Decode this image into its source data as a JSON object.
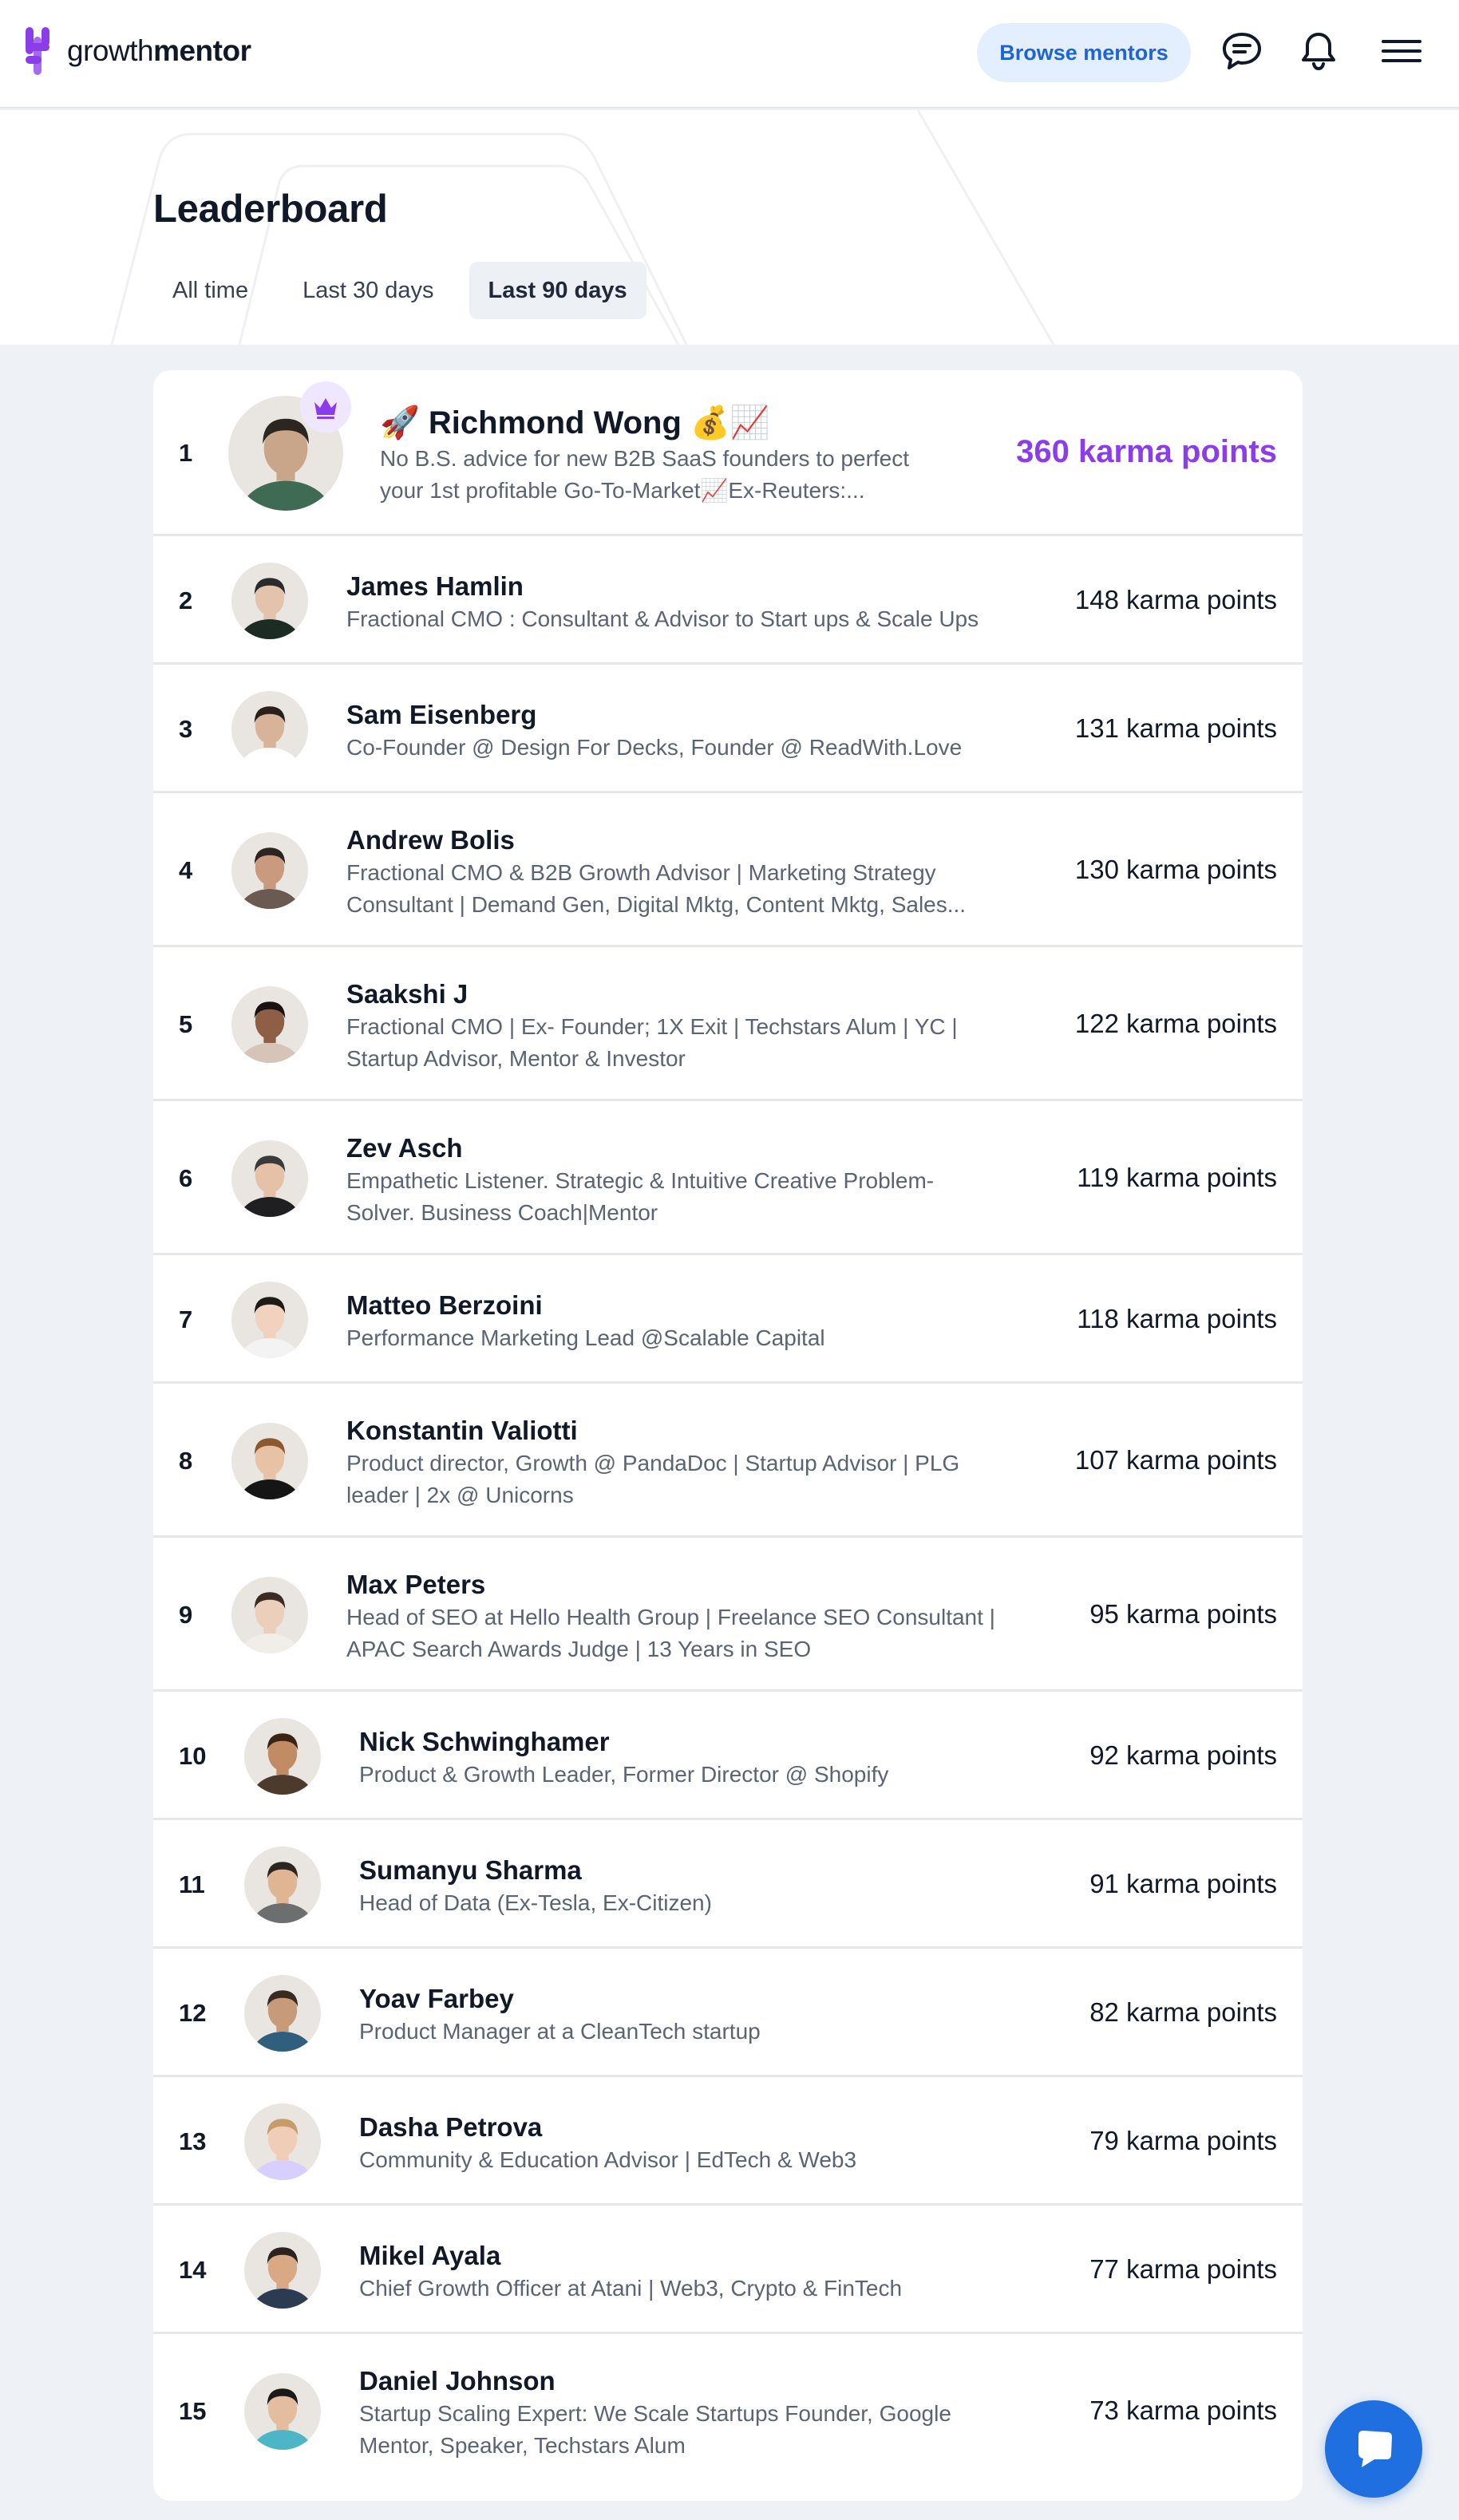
{
  "brand": {
    "name_regular": "growth",
    "name_bold": "mentor",
    "color": "#8b3dea"
  },
  "header": {
    "browse_label": "Browse mentors",
    "icons": [
      "messages-icon",
      "notifications-icon",
      "menu-icon"
    ]
  },
  "page": {
    "title": "Leaderboard",
    "tabs": [
      {
        "label": "All time",
        "active": false
      },
      {
        "label": "Last 30 days",
        "active": false
      },
      {
        "label": "Last 90 days",
        "active": true
      }
    ]
  },
  "leaderboard": [
    {
      "rank": "1",
      "name": "🚀 Richmond Wong 💰📈",
      "bio": [
        "No B.S. advice for new B2B SaaS founders to perfect",
        "your 1st profitable Go-To-Market📈Ex-Reuters:..."
      ],
      "points": "360 karma points",
      "badge": "crown-icon"
    },
    {
      "rank": "2",
      "name": "James Hamlin",
      "bio": [
        "Fractional CMO : Consultant & Advisor to Start ups & Scale Ups"
      ],
      "points": "148 karma points"
    },
    {
      "rank": "3",
      "name": "Sam Eisenberg",
      "bio": [
        "Co-Founder @ Design For Decks, Founder @ ReadWith.Love"
      ],
      "points": "131 karma points"
    },
    {
      "rank": "4",
      "name": "Andrew Bolis",
      "bio": [
        "Fractional CMO & B2B Growth Advisor | Marketing Strategy",
        "Consultant | Demand Gen, Digital Mktg, Content Mktg, Sales..."
      ],
      "points": "130 karma points"
    },
    {
      "rank": "5",
      "name": "Saakshi J",
      "bio": [
        "Fractional CMO | Ex- Founder; 1X Exit | Techstars Alum | YC |",
        "Startup Advisor, Mentor & Investor"
      ],
      "points": "122 karma points"
    },
    {
      "rank": "6",
      "name": "Zev Asch",
      "bio": [
        "Empathetic Listener. Strategic & Intuitive Creative Problem-",
        "Solver. Business Coach|Mentor"
      ],
      "points": "119 karma points"
    },
    {
      "rank": "7",
      "name": "Matteo Berzoini",
      "bio": [
        "Performance Marketing Lead @Scalable Capital"
      ],
      "points": "118 karma points"
    },
    {
      "rank": "8",
      "name": "Konstantin Valiotti",
      "bio": [
        "Product director, Growth @ PandaDoc | Startup Advisor | PLG",
        "leader | 2x @ Unicorns"
      ],
      "points": "107 karma points"
    },
    {
      "rank": "9",
      "name": "Max Peters",
      "bio": [
        "Head of SEO at Hello Health Group | Freelance SEO Consultant |",
        "APAC Search Awards Judge | 13 Years in SEO"
      ],
      "points": "95 karma points"
    },
    {
      "rank": "10",
      "name": "Nick Schwinghamer",
      "bio": [
        "Product & Growth Leader, Former Director @ Shopify"
      ],
      "points": "92 karma points"
    },
    {
      "rank": "11",
      "name": "Sumanyu Sharma",
      "bio": [
        "Head of Data (Ex-Tesla, Ex-Citizen)"
      ],
      "points": "91 karma points"
    },
    {
      "rank": "12",
      "name": "Yoav Farbey",
      "bio": [
        "Product Manager at a CleanTech startup"
      ],
      "points": "82 karma points"
    },
    {
      "rank": "13",
      "name": "Dasha Petrova",
      "bio": [
        "Community & Education Advisor | EdTech & Web3"
      ],
      "points": "79 karma points"
    },
    {
      "rank": "14",
      "name": "Mikel Ayala",
      "bio": [
        "Chief Growth Officer at Atani | Web3, Crypto & FinTech"
      ],
      "points": "77 karma points"
    },
    {
      "rank": "15",
      "name": "Daniel Johnson",
      "bio": [
        "Startup Scaling Expert: We Scale Startups Founder, Google",
        "Mentor, Speaker, Techstars Alum"
      ],
      "points": "73 karma points"
    }
  ],
  "chat_fab": {
    "icon": "chat-bubble-icon"
  }
}
